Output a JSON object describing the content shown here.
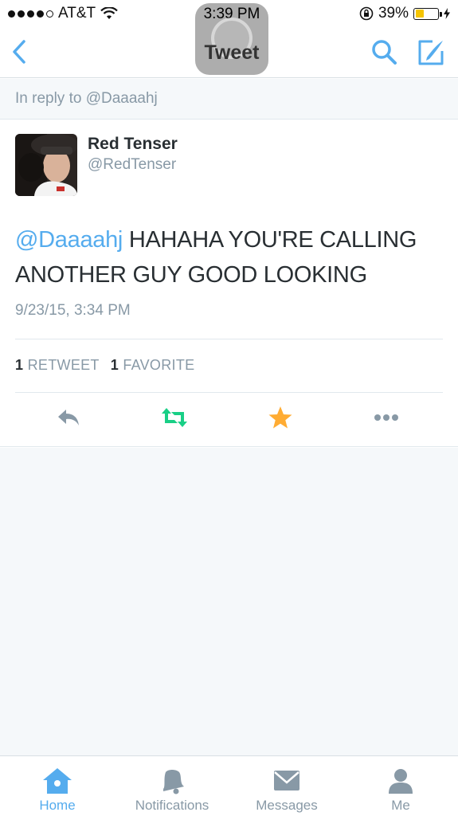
{
  "status_bar": {
    "carrier": "AT&T",
    "time": "3:39 PM",
    "battery": "39%",
    "battery_level": 0.39
  },
  "nav": {
    "title": "Tweet"
  },
  "reply_context": "In reply to @Daaaahj",
  "tweet": {
    "name": "Red Tenser",
    "handle": "@RedTenser",
    "mention": "@Daaaahj",
    "body": " HAHAHA YOU'RE CALLING ANOTHER GUY GOOD LOOKING",
    "timestamp": "9/23/15, 3:34 PM",
    "retweet_count": "1",
    "retweet_label": "RETWEET",
    "favorite_count": "1",
    "favorite_label": "FAVORITE"
  },
  "colors": {
    "accent": "#55acee",
    "retweeted": "#19cf86",
    "favorited": "#ffac33",
    "muted": "#8899a6"
  },
  "actions": [
    "reply-icon",
    "retweet-icon",
    "favorite-icon",
    "more-icon"
  ],
  "tabs": [
    {
      "label": "Home",
      "icon": "home-icon",
      "active": true
    },
    {
      "label": "Notifications",
      "icon": "bell-icon",
      "active": false
    },
    {
      "label": "Messages",
      "icon": "envelope-icon",
      "active": false
    },
    {
      "label": "Me",
      "icon": "person-icon",
      "active": false
    }
  ]
}
